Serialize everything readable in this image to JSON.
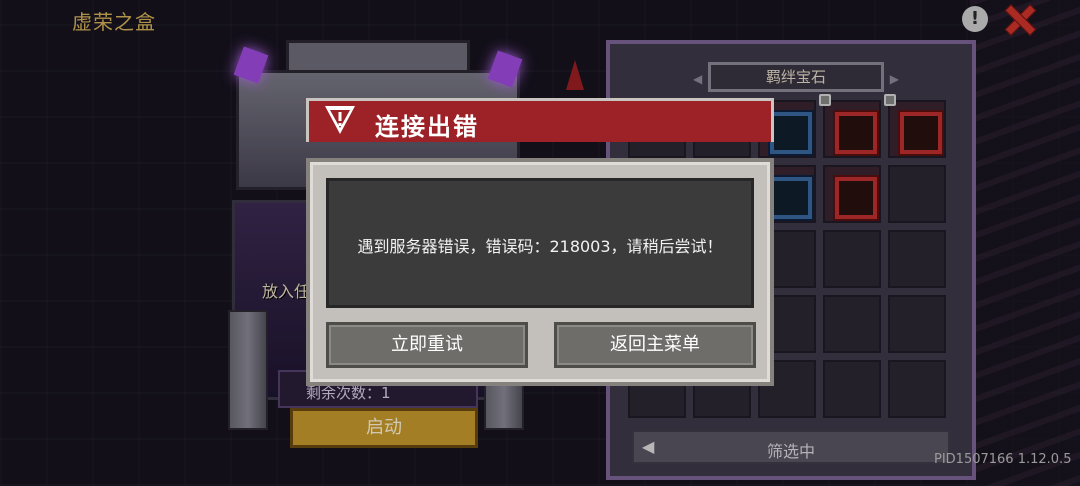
{
  "window": {
    "title": "虚荣之盒"
  },
  "chest": {
    "put_label": "放入任",
    "remaining_label": "剩余次数：1",
    "start_button": "启动"
  },
  "panel": {
    "title": "羁绊宝石",
    "filter_label": "筛选中"
  },
  "footer": {
    "build_id": "PID1507166 1.12.0.5"
  },
  "dialog": {
    "title": "连接出错",
    "message": "遇到服务器错误，错误码：218003，请稍后尝试！",
    "retry_button": "立即重试",
    "menu_button": "返回主菜单"
  },
  "colors": {
    "dialog_header": "#9c2228",
    "dialog_body": "#c3c0bc",
    "start_button": "#c79a2c",
    "close_icon": "#d0342c"
  }
}
